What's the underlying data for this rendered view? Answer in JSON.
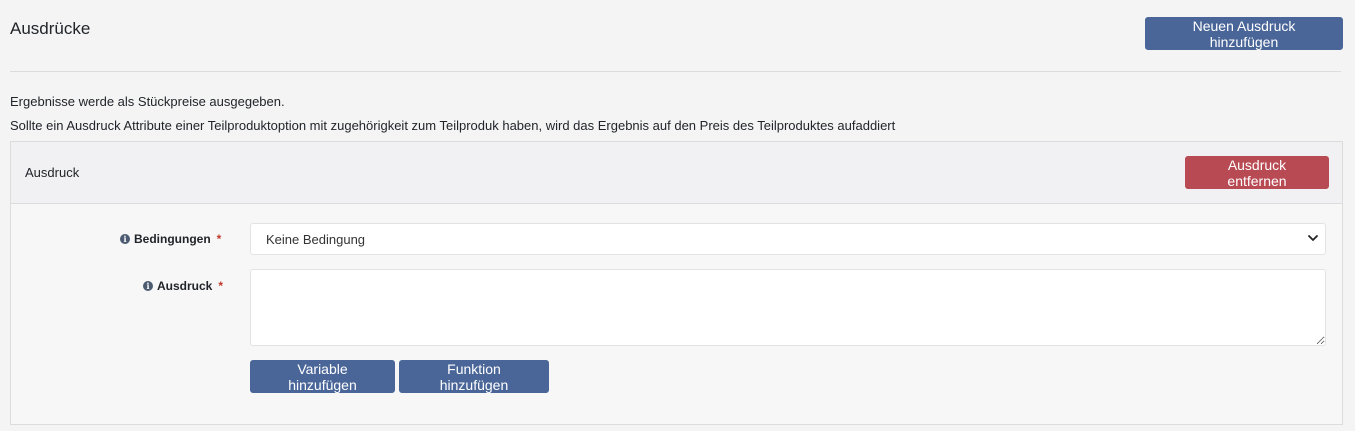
{
  "header": {
    "title": "Ausdrücke",
    "add_button_label": "Neuen Ausdruck hinzufügen"
  },
  "info": {
    "line1": "Ergebnisse werde als Stückpreise ausgegeben.",
    "line2": "Sollte ein Ausdruck Attribute einer Teilproduktoption mit zugehörigkeit zum Teilproduk haben, wird das Ergebnis auf den Preis des Teilproduktes aufaddiert"
  },
  "card": {
    "title": "Ausdruck",
    "remove_button_label": "Ausdruck entfernen",
    "conditions": {
      "label": "Bedingungen",
      "required_mark": "*",
      "selected_value": "Keine Bedingung"
    },
    "expression": {
      "label": "Ausdruck",
      "required_mark": "*",
      "value": ""
    },
    "add_variable_label": "Variable hinzufügen",
    "add_function_label": "Funktion hinzufügen"
  },
  "colors": {
    "primary": "#4a6699",
    "danger": "#b84a54",
    "background": "#f4f4f5"
  },
  "icons": {
    "info": "info-circle-icon",
    "chevron": "chevron-down-icon"
  }
}
